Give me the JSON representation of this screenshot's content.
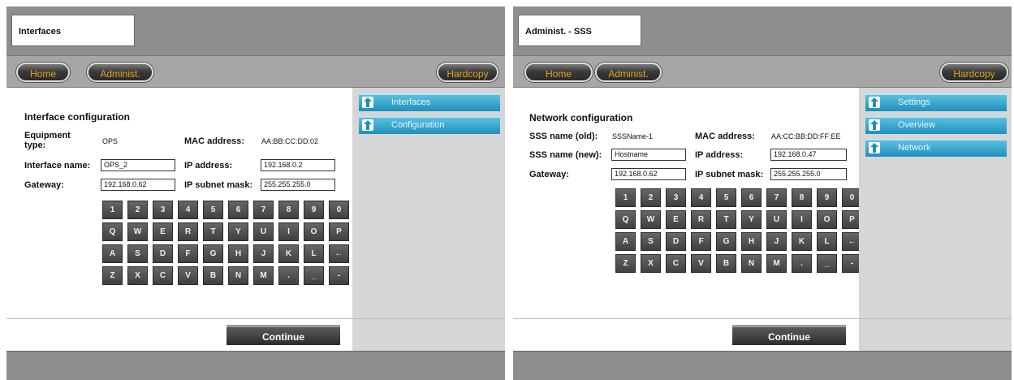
{
  "left": {
    "window_title": "Interfaces",
    "nav": {
      "home": "Home",
      "admin": "Administ.",
      "hardcopy": "Hardcopy"
    },
    "section_title": "Interface configuration",
    "equipment_type_label": "Equipment type:",
    "equipment_type_value": "OPS",
    "mac_label": "MAC address:",
    "mac_value": "AA:BB:CC:DD:02",
    "interface_name_label": "Interface name:",
    "interface_name_value": "OPS_2",
    "ip_label": "IP address:",
    "ip_value": "192.168.0.2",
    "gateway_label": "Gateway:",
    "gateway_value": "192.168.0.62",
    "subnet_label": "IP subnet mask:",
    "subnet_value": "255.255.255.0",
    "menu": [
      "Interfaces",
      "Configuration"
    ],
    "continue_label": "Continue"
  },
  "right": {
    "window_title": "Administ. - SSS",
    "nav": {
      "home": "Home",
      "admin": "Administ.",
      "hardcopy": "Hardcopy"
    },
    "section_title": "Network configuration",
    "sss_old_label": "SSS name (old):",
    "sss_old_value": "SSSName-1",
    "mac_label": "MAC address:",
    "mac_value": "AA:CC:BB:DD:FF:EE",
    "sss_new_label": "SSS name (new):",
    "sss_new_value": "Hostname",
    "ip_label": "IP address:",
    "ip_value": "192.168.0.47",
    "gateway_label": "Gateway:",
    "gateway_value": "192.168.0.62",
    "subnet_label": "IP subnet mask:",
    "subnet_value": "255.255.255.0",
    "menu": [
      "Settings",
      "Overview",
      "Network"
    ],
    "continue_label": "Continue"
  },
  "keyboard": {
    "rows": [
      [
        "1",
        "2",
        "3",
        "4",
        "5",
        "6",
        "7",
        "8",
        "9",
        "0"
      ],
      [
        "Q",
        "W",
        "E",
        "R",
        "T",
        "Y",
        "U",
        "I",
        "O",
        "P"
      ],
      [
        "A",
        "S",
        "D",
        "F",
        "G",
        "H",
        "J",
        "K",
        "L",
        "←"
      ],
      [
        "Z",
        "X",
        "C",
        "V",
        "B",
        "N",
        "M",
        ".",
        "_",
        "-"
      ]
    ]
  },
  "colors": {
    "accent": "#1d8fbe",
    "nav_text": "#e8a020",
    "bar_gray": "#8e8e8e",
    "side_gray": "#d6d6d6"
  }
}
